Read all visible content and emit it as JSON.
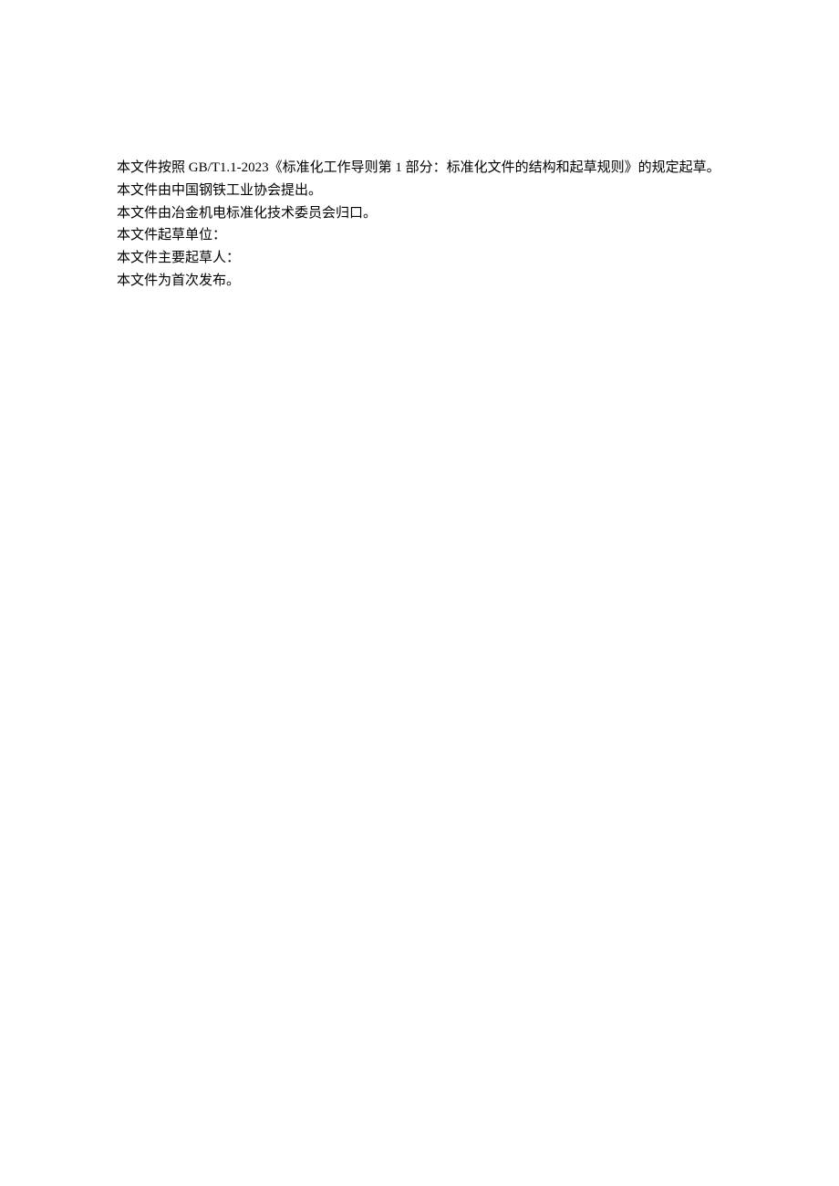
{
  "paragraphs": [
    "本文件按照 GB/T1.1-2023《标准化工作导则第 1 部分：标准化文件的结构和起草规则》的规定起草。",
    "本文件由中国钢铁工业协会提出。",
    "本文件由冶金机电标准化技术委员会归口。",
    "本文件起草单位：",
    "本文件主要起草人：",
    "本文件为首次发布。"
  ]
}
